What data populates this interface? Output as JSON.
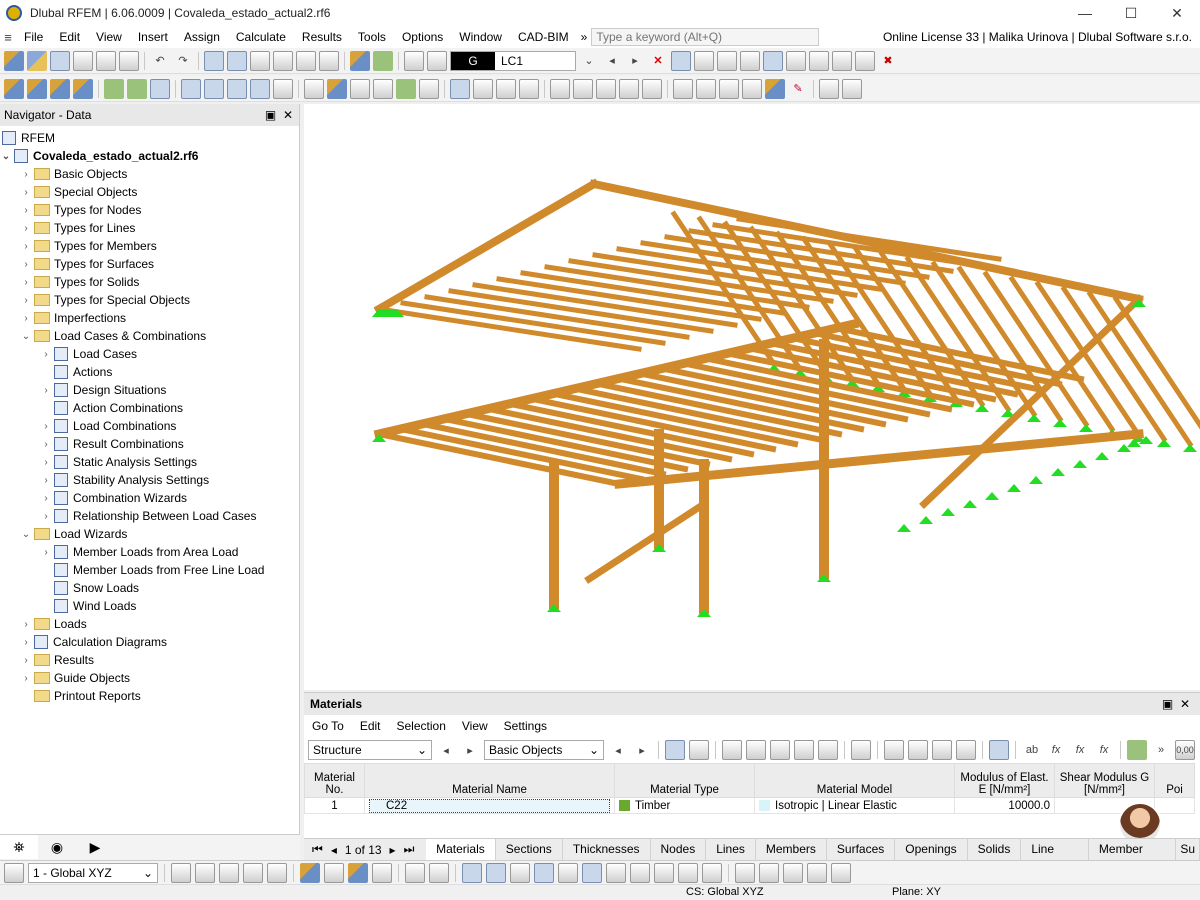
{
  "window": {
    "title": "Dlubal RFEM | 6.06.0009 | Covaleda_estado_actual2.rf6",
    "minimize": "—",
    "maximize": "☐",
    "close": "✕"
  },
  "menu": {
    "items": [
      "File",
      "Edit",
      "View",
      "Insert",
      "Assign",
      "Calculate",
      "Results",
      "Tools",
      "Options",
      "Window",
      "CAD-BIM"
    ],
    "more": "»",
    "search_placeholder": "Type a keyword (Alt+Q)",
    "license": "Online License 33 | Malika Urinova | Dlubal Software s.r.o."
  },
  "toolbar": {
    "load_case_type": "G",
    "load_case": "LC1"
  },
  "navigator": {
    "title": "Navigator - Data",
    "root": "RFEM",
    "file": "Covaleda_estado_actual2.rf6",
    "items": [
      {
        "label": "Basic Objects",
        "level": 1,
        "exp": "›",
        "icon": "folder"
      },
      {
        "label": "Special Objects",
        "level": 1,
        "exp": "›",
        "icon": "folder"
      },
      {
        "label": "Types for Nodes",
        "level": 1,
        "exp": "›",
        "icon": "folder"
      },
      {
        "label": "Types for Lines",
        "level": 1,
        "exp": "›",
        "icon": "folder"
      },
      {
        "label": "Types for Members",
        "level": 1,
        "exp": "›",
        "icon": "folder"
      },
      {
        "label": "Types for Surfaces",
        "level": 1,
        "exp": "›",
        "icon": "folder"
      },
      {
        "label": "Types for Solids",
        "level": 1,
        "exp": "›",
        "icon": "folder"
      },
      {
        "label": "Types for Special Objects",
        "level": 1,
        "exp": "›",
        "icon": "folder"
      },
      {
        "label": "Imperfections",
        "level": 1,
        "exp": "›",
        "icon": "folder"
      },
      {
        "label": "Load Cases & Combinations",
        "level": 1,
        "exp": "⌄",
        "icon": "folder"
      },
      {
        "label": "Load Cases",
        "level": 2,
        "exp": "›",
        "icon": "item"
      },
      {
        "label": "Actions",
        "level": 2,
        "exp": "",
        "icon": "item"
      },
      {
        "label": "Design Situations",
        "level": 2,
        "exp": "›",
        "icon": "item"
      },
      {
        "label": "Action Combinations",
        "level": 2,
        "exp": "",
        "icon": "item"
      },
      {
        "label": "Load Combinations",
        "level": 2,
        "exp": "›",
        "icon": "item"
      },
      {
        "label": "Result Combinations",
        "level": 2,
        "exp": "›",
        "icon": "item"
      },
      {
        "label": "Static Analysis Settings",
        "level": 2,
        "exp": "›",
        "icon": "item"
      },
      {
        "label": "Stability Analysis Settings",
        "level": 2,
        "exp": "›",
        "icon": "item"
      },
      {
        "label": "Combination Wizards",
        "level": 2,
        "exp": "›",
        "icon": "item"
      },
      {
        "label": "Relationship Between Load Cases",
        "level": 2,
        "exp": "›",
        "icon": "item"
      },
      {
        "label": "Load Wizards",
        "level": 1,
        "exp": "⌄",
        "icon": "folder"
      },
      {
        "label": "Member Loads from Area Load",
        "level": 2,
        "exp": "›",
        "icon": "item"
      },
      {
        "label": "Member Loads from Free Line Load",
        "level": 2,
        "exp": "",
        "icon": "item"
      },
      {
        "label": "Snow Loads",
        "level": 2,
        "exp": "",
        "icon": "item"
      },
      {
        "label": "Wind Loads",
        "level": 2,
        "exp": "",
        "icon": "item"
      },
      {
        "label": "Loads",
        "level": 1,
        "exp": "›",
        "icon": "folder"
      },
      {
        "label": "Calculation Diagrams",
        "level": 1,
        "exp": "›",
        "icon": "item"
      },
      {
        "label": "Results",
        "level": 1,
        "exp": "›",
        "icon": "folder"
      },
      {
        "label": "Guide Objects",
        "level": 1,
        "exp": "›",
        "icon": "folder"
      },
      {
        "label": "Printout Reports",
        "level": 1,
        "exp": "",
        "icon": "folder"
      }
    ]
  },
  "materials": {
    "title": "Materials",
    "menu": [
      "Go To",
      "Edit",
      "Selection",
      "View",
      "Settings"
    ],
    "filter1": "Structure",
    "filter2": "Basic Objects",
    "headers": {
      "no": "Material No.",
      "name": "Material Name",
      "type": "Material Type",
      "model": "Material Model",
      "e": "Modulus of Elast. E [N/mm²]",
      "g": "Shear Modulus G [N/mm²]",
      "poi": "Poi"
    },
    "rows": [
      {
        "no": "1",
        "name": "C22",
        "type": "Timber",
        "model": "Isotropic | Linear Elastic",
        "e": "10000.0",
        "g": ""
      }
    ],
    "type_color": "#6aa92e"
  },
  "tabs": {
    "page": "1 of 13",
    "items": [
      "Materials",
      "Sections",
      "Thicknesses",
      "Nodes",
      "Lines",
      "Members",
      "Surfaces",
      "Openings",
      "Solids",
      "Line Sets",
      "Member Sets",
      "Su"
    ],
    "active": "Materials"
  },
  "bottom": {
    "view": "1 - Global XYZ"
  },
  "status": {
    "cs": "CS: Global XYZ",
    "plane": "Plane: XY"
  },
  "colors": {
    "timber": "#d08a2b",
    "support": "#22dd22"
  }
}
